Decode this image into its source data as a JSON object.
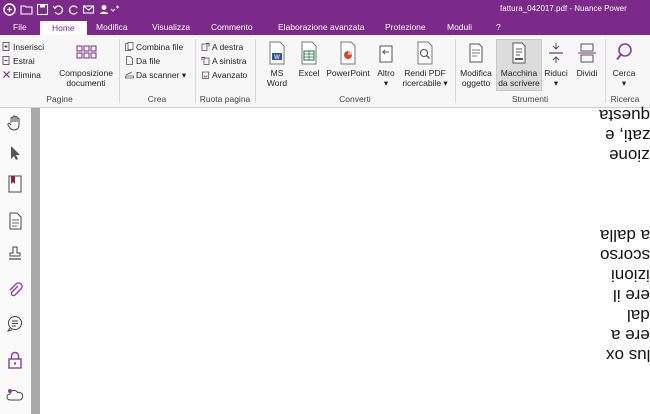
{
  "titlebar": {
    "title": "fattura_042017.pdf - Nuance Power"
  },
  "menu": {
    "tabs": [
      "File",
      "Home",
      "Modifica",
      "Visualizza",
      "Commento",
      "Elaborazione avanzata",
      "Protezione",
      "Moduli",
      "?"
    ],
    "active": "Home"
  },
  "ribbon": {
    "pagine": {
      "group_label": "Pagine",
      "inserisci": "Inserisci",
      "estrai": "Estrai",
      "elimina": "Elimina",
      "composizione_line1": "Composizione",
      "composizione_line2": "documenti"
    },
    "crea": {
      "group_label": "Crea",
      "combina": "Combina file",
      "da_file": "Da file",
      "da_scanner": "Da scanner ▾"
    },
    "ruota": {
      "group_label": "Ruota pagina",
      "destra": "A destra",
      "sinistra": "A sinistra",
      "avanzato": "Avanzato"
    },
    "converti": {
      "group_label": "Converti",
      "ms_word_line1": "MS",
      "ms_word_line2": "Word",
      "excel": "Excel",
      "powerpoint": "PowerPoint",
      "altro": "Altro",
      "altro_arrow": "▾",
      "rendi_line1": "Rendi PDF",
      "rendi_line2": "ricercabile ▾"
    },
    "strumenti": {
      "group_label": "Strumenti",
      "modifica_line1": "Modifica",
      "modifica_line2": "oggetto",
      "macchina_line1": "Macchina",
      "macchina_line2": "da scrivere",
      "riduci": "Riduci",
      "riduci_arrow": "▾",
      "dividi": "Dividi"
    },
    "ricerca": {
      "group_label": "Ricerca",
      "cerca": "Cerca",
      "cerca_arrow": "▾"
    }
  },
  "document": {
    "lines": [
      "questa",
      "zati, e",
      "zione",
      "a dalla",
      "scorso",
      "izioni",
      "ere il",
      "dal",
      "ere a",
      "lus ox"
    ]
  },
  "colors": {
    "brand": "#7b2a8a",
    "accent_purple": "#8a3c9c"
  }
}
